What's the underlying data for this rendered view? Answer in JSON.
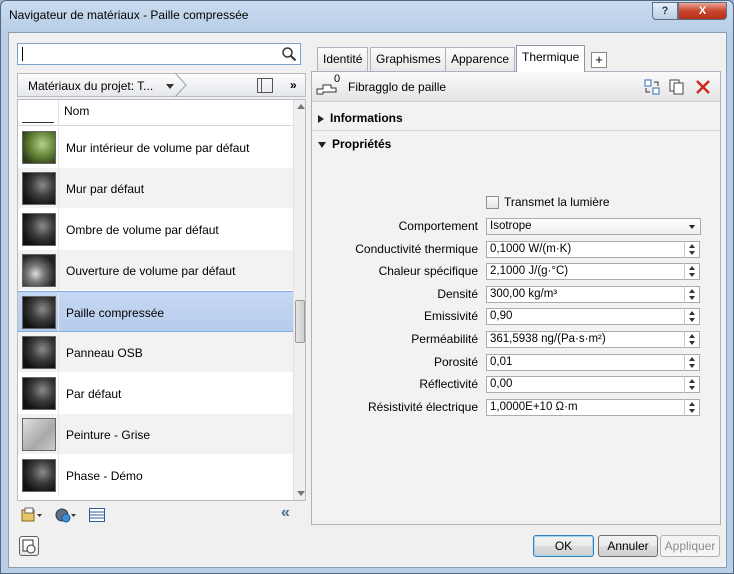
{
  "window": {
    "title": "Navigateur de matériaux - Paille compressée",
    "help_label": "?",
    "close_label": "X"
  },
  "search": {
    "value": "",
    "placeholder": ""
  },
  "project_bar": {
    "label": "Matériaux du projet: T...",
    "more_label": "»"
  },
  "list": {
    "column_name": "Nom",
    "items": [
      {
        "name": "Mur intérieur de volume par défaut",
        "thumb": "green"
      },
      {
        "name": "Mur par défaut",
        "thumb": "dark"
      },
      {
        "name": "Ombre de volume par défaut",
        "thumb": "dark"
      },
      {
        "name": "Ouverture de volume par défaut",
        "thumb": "cut"
      },
      {
        "name": "Paille compressée",
        "thumb": "dark",
        "selected": true
      },
      {
        "name": "Panneau OSB",
        "thumb": "dark"
      },
      {
        "name": "Par défaut",
        "thumb": "dark"
      },
      {
        "name": "Peinture - Grise",
        "thumb": "grey"
      },
      {
        "name": "Phase - Démo",
        "thumb": "dark"
      }
    ]
  },
  "left_footer": {
    "collapse_label": "«"
  },
  "tabs": [
    {
      "label": "Identité"
    },
    {
      "label": "Graphismes"
    },
    {
      "label": "Apparence"
    },
    {
      "label": "Thermique",
      "active": true
    }
  ],
  "tab_add_label": "+",
  "asset": {
    "users_count": "0",
    "name": "Fibragglo de paille"
  },
  "sections": {
    "informations": "Informations",
    "proprietes": "Propriétés"
  },
  "transmet": {
    "label": "Transmet la lumière",
    "checked": false
  },
  "properties": [
    {
      "label": "Comportement",
      "value": "Isotrope",
      "type": "combo"
    },
    {
      "label": "Conductivité thermique",
      "value": "0,1000 W/(m·K)",
      "type": "spin"
    },
    {
      "label": "Chaleur spécifique",
      "value": "2,1000 J/(g·°C)",
      "type": "spin"
    },
    {
      "label": "Densité",
      "value": "300,00 kg/m³",
      "type": "spin"
    },
    {
      "label": "Emissivité",
      "value": "0,90",
      "type": "spin"
    },
    {
      "label": "Perméabilité",
      "value": "361,5938 ng/(Pa·s·m²)",
      "type": "spin"
    },
    {
      "label": "Porosité",
      "value": "0,01",
      "type": "spin"
    },
    {
      "label": "Réflectivité",
      "value": "0,00",
      "type": "spin"
    },
    {
      "label": "Résistivité électrique",
      "value": "1,0000E+10 Ω·m",
      "type": "spin"
    }
  ],
  "buttons": {
    "ok": "OK",
    "cancel": "Annuler",
    "apply": "Appliquer"
  },
  "colors": {
    "selection": "#b6ccec",
    "delete": "#d0291b",
    "accent": "#3c7fb1"
  }
}
